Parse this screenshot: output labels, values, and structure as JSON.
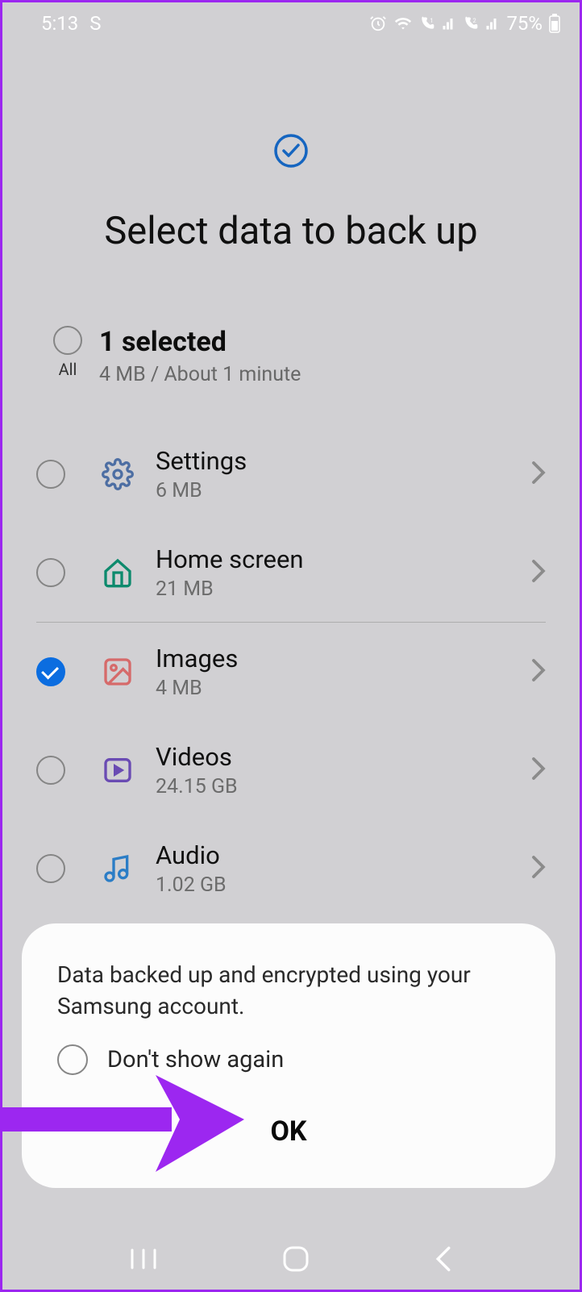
{
  "statusbar": {
    "time": "5:13",
    "app_indicator": "S",
    "battery_pct": "75%"
  },
  "header": {
    "title": "Select data to back up"
  },
  "summary": {
    "all_label": "All",
    "selected_label": "1 selected",
    "details": "4 MB / About 1 minute"
  },
  "items": [
    {
      "id": "settings",
      "label": "Settings",
      "size": "6 MB",
      "checked": false,
      "icon": "gear",
      "color": "#4d6ea3"
    },
    {
      "id": "home-screen",
      "label": "Home screen",
      "size": "21 MB",
      "checked": false,
      "icon": "home",
      "color": "#0d8a6d"
    },
    {
      "id": "images",
      "label": "Images",
      "size": "4 MB",
      "checked": true,
      "icon": "image",
      "color": "#d66a6a"
    },
    {
      "id": "videos",
      "label": "Videos",
      "size": "24.15 GB",
      "checked": false,
      "icon": "video",
      "color": "#6a4bb3"
    },
    {
      "id": "audio",
      "label": "Audio",
      "size": "1.02 GB",
      "checked": false,
      "icon": "audio",
      "color": "#2b7dc6"
    }
  ],
  "popup": {
    "message": "Data backed up and encrypted using your Samsung account.",
    "dont_show_label": "Don't show again",
    "ok_label": "OK"
  },
  "annotation": {
    "arrow_color": "#9c27f0"
  }
}
